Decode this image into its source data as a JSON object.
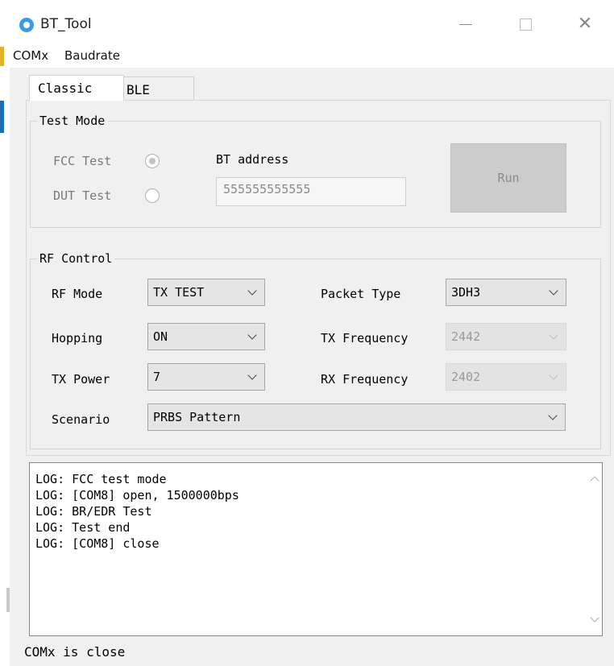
{
  "window": {
    "title": "BT_Tool"
  },
  "menu": {
    "items": [
      "COMx",
      "Baudrate"
    ]
  },
  "tabs": {
    "classic": "Classic",
    "ble": "BLE"
  },
  "test_mode": {
    "group_label": "Test Mode",
    "fcc_label": "FCC Test",
    "dut_label": "DUT Test",
    "fcc_checked": true,
    "bt_address_label": "BT address",
    "bt_address_value": "555555555555",
    "run_label": "Run"
  },
  "rf_control": {
    "group_label": "RF Control",
    "rf_mode_label": "RF Mode",
    "rf_mode_value": "TX TEST",
    "hopping_label": "Hopping",
    "hopping_value": "ON",
    "tx_power_label": "TX Power",
    "tx_power_value": "7",
    "scenario_label": "Scenario",
    "scenario_value": "PRBS Pattern",
    "packet_type_label": "Packet Type",
    "packet_type_value": "3DH3",
    "tx_freq_label": "TX Frequency",
    "tx_freq_value": "2442",
    "rx_freq_label": "RX Frequency",
    "rx_freq_value": "2402"
  },
  "log": {
    "lines": [
      "LOG: FCC test mode",
      "LOG: [COM8] open, 1500000bps",
      "LOG: BR/EDR Test",
      "LOG: Test end",
      "LOG: [COM8] close"
    ]
  },
  "status": {
    "text": "COMx is close"
  }
}
